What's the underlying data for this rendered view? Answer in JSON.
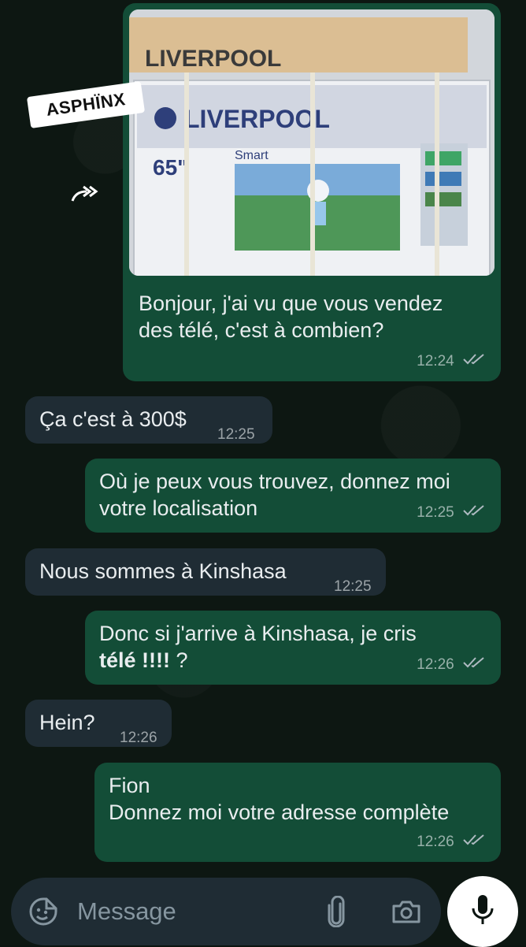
{
  "watermark": "ASPHÏNX",
  "photo_text": {
    "brand": "LIVERPOOL",
    "size": "65\"",
    "smart": "Smart"
  },
  "messages": [
    {
      "dir": "out",
      "text": "Bonjour, j'ai vu que vous vendez des télé, c'est à combien?",
      "line1": "Bonjour, j'ai vu que vous vendez",
      "line2": "des télé, c'est à combien?",
      "time": "12:24",
      "has_image": true
    },
    {
      "dir": "in",
      "text": "Ça c'est à 300$",
      "time": "12:25"
    },
    {
      "dir": "out",
      "line1": "Où je peux vous trouvez, donnez moi",
      "line2": "votre localisation",
      "time": "12:25"
    },
    {
      "dir": "in",
      "text": "Nous sommes à Kinshasa",
      "time": "12:25"
    },
    {
      "dir": "out",
      "line1": "Donc si j'arrive à Kinshasa, je cris",
      "line2_bold": "télé !!!!",
      "line2_rest": " ?",
      "time": "12:26"
    },
    {
      "dir": "in",
      "text": "Hein?",
      "time": "12:26"
    },
    {
      "dir": "out",
      "line1": "Fion",
      "line2": "Donnez moi votre adresse complète",
      "time": "12:26"
    }
  ],
  "input": {
    "placeholder": "Message",
    "icons": [
      "sticker-icon",
      "attach-icon",
      "camera-icon",
      "mic-icon"
    ]
  },
  "colors": {
    "outgoing_bubble": "#134d37",
    "incoming_bubble": "#1f2c34",
    "background": "#0d1712"
  }
}
